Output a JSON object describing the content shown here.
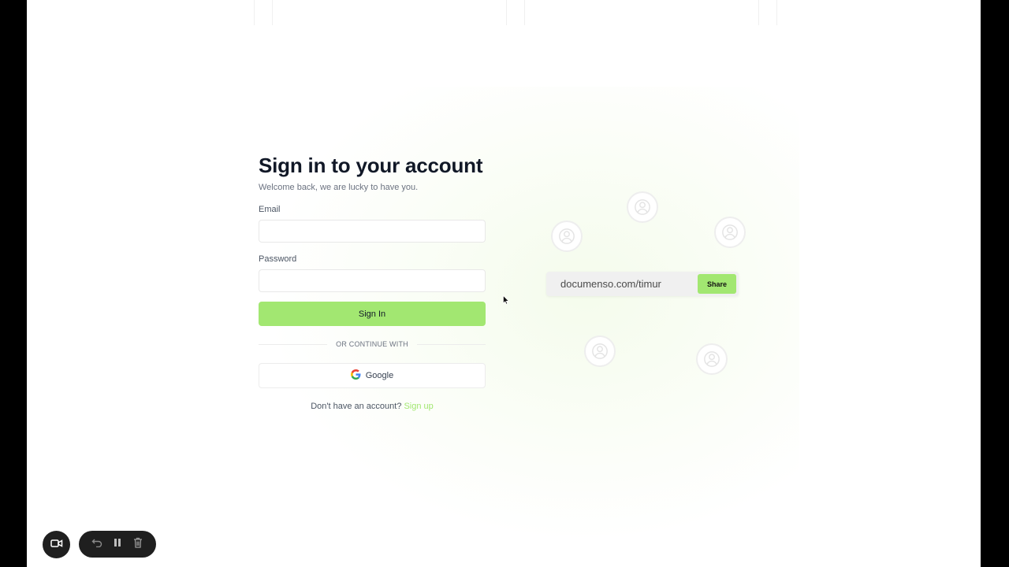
{
  "signin": {
    "title": "Sign in to your account",
    "subtitle": "Welcome back, we are lucky to have you.",
    "email_label": "Email",
    "email_value": "",
    "password_label": "Password",
    "password_value": "",
    "signin_button": "Sign In",
    "divider_text": "OR CONTINUE WITH",
    "google_button": "Google",
    "signup_prompt": "Don't have an account?",
    "signup_link": "Sign up"
  },
  "illustration": {
    "share_url": "documenso.com/timur",
    "share_button": "Share"
  },
  "recorder": {
    "icons": [
      "camera-icon",
      "undo-icon",
      "pause-icon",
      "trash-icon"
    ]
  },
  "colors": {
    "accent": "#a2e771",
    "title": "#111827",
    "muted": "#6b7280",
    "recorder_bg": "#1f1f1f"
  }
}
